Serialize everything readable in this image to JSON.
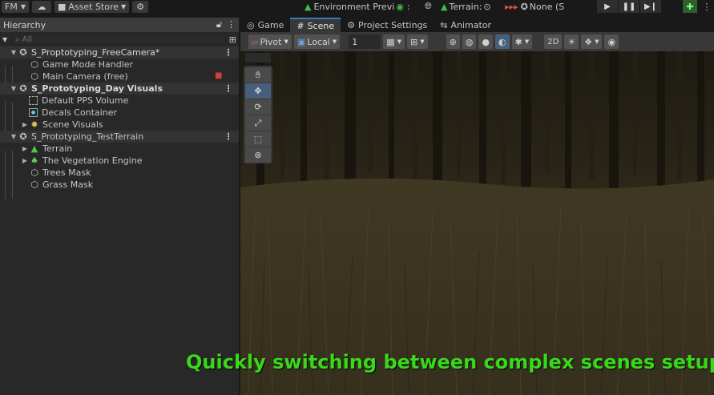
{
  "topbar": {
    "account": "FM",
    "asset_store": "Asset Store",
    "env_preview": "Environment Previ",
    "terrain": "Terrain:",
    "none": "None (S"
  },
  "hierarchy": {
    "title": "Hierarchy",
    "search_placeholder": "All",
    "rows": [
      {
        "label": "S_Proptotyping_FreeCamera*"
      },
      {
        "label": "Game Mode Handler"
      },
      {
        "label": "Main Camera (free)"
      },
      {
        "label": "S_Prototyping_Day Visuals"
      },
      {
        "label": "Default PPS Volume"
      },
      {
        "label": "Decals Container"
      },
      {
        "label": "Scene Visuals"
      },
      {
        "label": "S_Prototyping_TestTerrain"
      },
      {
        "label": "Terrain"
      },
      {
        "label": "The Vegetation Engine"
      },
      {
        "label": "Trees Mask"
      },
      {
        "label": "Grass Mask"
      }
    ]
  },
  "scene_tabs": [
    "Game",
    "Scene",
    "Project Settings",
    "Animator"
  ],
  "scene_toolbar": {
    "pivot": "Pivot",
    "local": "Local",
    "grid_value": "1",
    "mode_2d": "2D"
  },
  "caption": "Quickly switching between complex scenes setups",
  "colors": {
    "accent": "#3a79bb",
    "caption": "#3ad81b"
  }
}
